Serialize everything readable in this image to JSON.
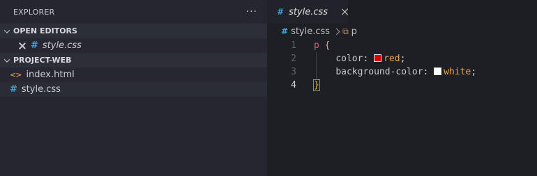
{
  "sidebar": {
    "title": "EXPLORER",
    "more_icon": "ellipsis-icon",
    "open_editors": {
      "label": "OPEN EDITORS",
      "items": [
        {
          "name": "style.css",
          "icon": "css-hash-icon"
        }
      ]
    },
    "project": {
      "label": "PROJECT-WEB",
      "files": [
        {
          "name": "index.html",
          "icon": "html-brackets-icon"
        },
        {
          "name": "style.css",
          "icon": "css-hash-icon"
        }
      ]
    }
  },
  "editor": {
    "tab": {
      "label": "style.css"
    },
    "breadcrumb": {
      "file": "style.css",
      "symbol": "p"
    },
    "lines": [
      {
        "num": "1",
        "selector": "p",
        "brace": "{"
      },
      {
        "num": "2",
        "prop": "color:",
        "value": "red",
        "swatch": "#e00000",
        "end": ";"
      },
      {
        "num": "3",
        "prop": "background-color:",
        "value": "white",
        "swatch": "#ffffff",
        "end": ";"
      },
      {
        "num": "4",
        "brace": "}"
      }
    ]
  },
  "colors": {
    "sidebar_bg": "#252630",
    "editor_bg": "#1e1f25",
    "css_icon": "#3fa1d6",
    "html_icon": "#e38c33",
    "selector": "#e25a6f",
    "value": "#e9a45a",
    "brace": "#d9b43a"
  }
}
